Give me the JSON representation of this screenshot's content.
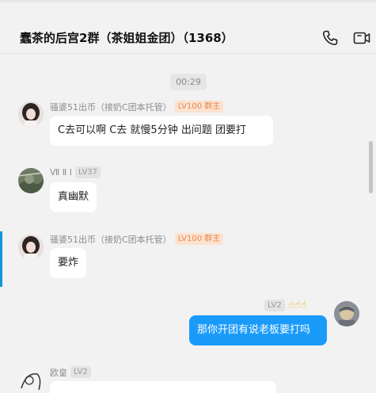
{
  "header": {
    "title": "蠢茶的后宫2群（茶姐姐金团）（1368）",
    "phone_icon": "phone-icon",
    "video_icon": "video-call-icon"
  },
  "timestamp": "00:29",
  "messages": [
    {
      "sender": "骚婆51出币（接奶C团本托管）",
      "level": "LV100 群主",
      "text": "C去可以啊  C去 就慢5分钟  出问题 团要打",
      "avatar": "avatar-girl"
    },
    {
      "sender": "Ⅶ Ⅱ Ⅰ",
      "level": "LV37",
      "text": "真幽默",
      "avatar": "avatar-landscape"
    },
    {
      "sender": "骚婆51出币（接奶C团本托管）",
      "level": "LV100 群主",
      "text": "要炸",
      "avatar": "avatar-girl"
    },
    {
      "sender": "",
      "level": "LV2",
      "emoji": "☝☝☝",
      "text": "那你开团有说老板要打吗",
      "avatar": "avatar-self",
      "mine": true
    },
    {
      "sender": "欧皇",
      "level": "LV2",
      "text": "",
      "avatar": "avatar-sketch"
    }
  ],
  "colors": {
    "background": "#f2f2f2",
    "my_bubble": "#1a9bfa",
    "owner_badge": "#fde2cf",
    "active_marker": "#1296db"
  }
}
